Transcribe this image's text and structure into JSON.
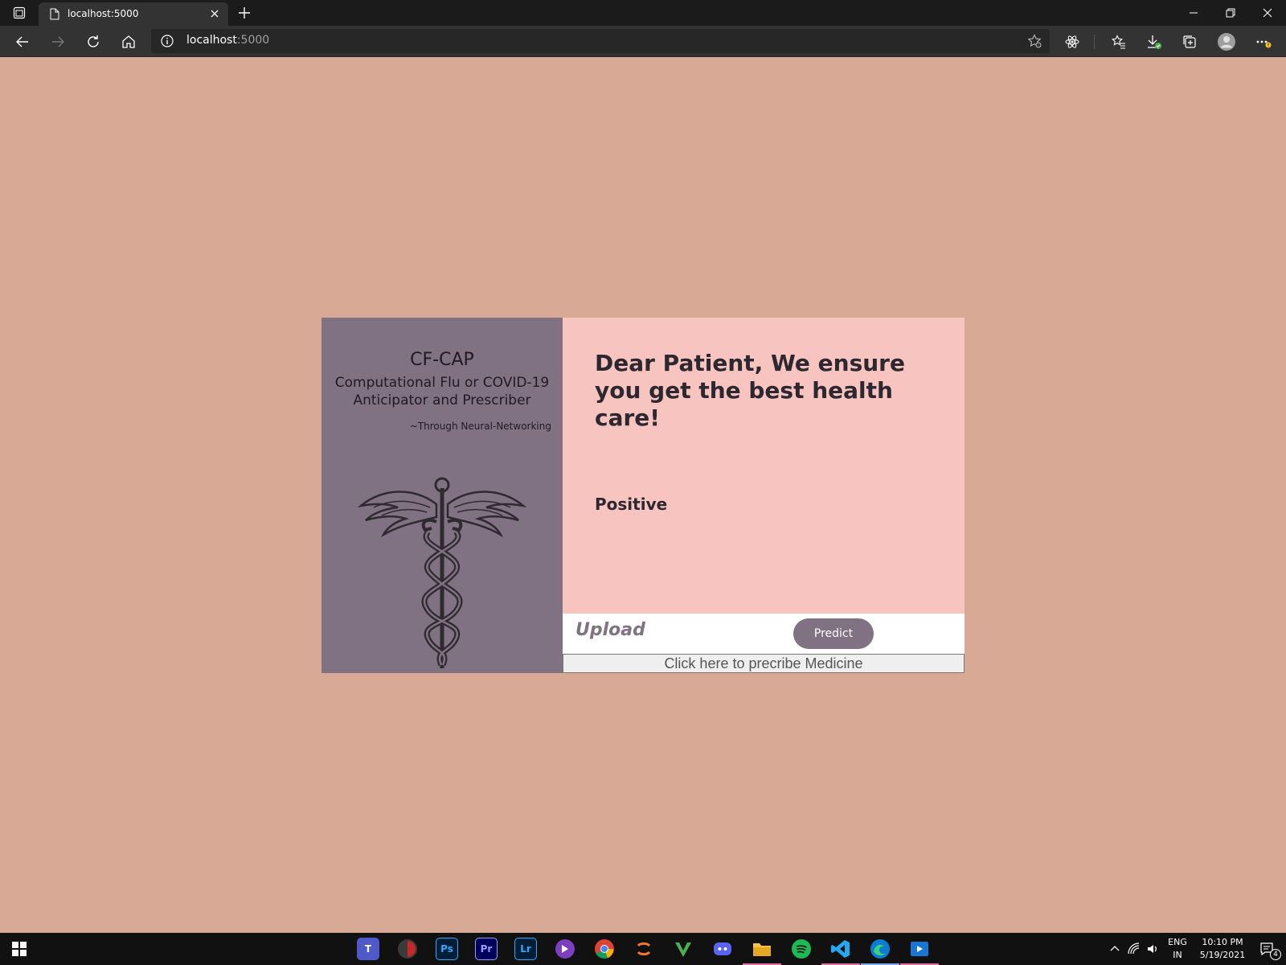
{
  "browser": {
    "tab_title": "localhost:5000",
    "address_host": "localhost",
    "address_port": ":5000"
  },
  "page": {
    "brand": "CF-CAP",
    "full_name_line1": "Computational Flu or COVID-19",
    "full_name_line2": "Anticipator and Prescriber",
    "tagline": "~Through Neural-Networking",
    "greeting": "Dear Patient, We ensure you get the best health care!",
    "result": "Positive",
    "upload_label": "Upload",
    "predict_label": "Predict",
    "prescribe_label": "Click here to precribe Medicine"
  },
  "colors": {
    "page_background": "#d8a994",
    "left_panel": "#807282",
    "right_panel": "#f7c4c0",
    "accent": "#807282"
  },
  "taskbar": {
    "apps": [
      "teams-icon",
      "app-icon",
      "photoshop-icon",
      "premiere-icon",
      "lightroom-icon",
      "app-icon",
      "chrome-icon",
      "app-icon",
      "app-icon",
      "discord-icon",
      "file-explorer-icon",
      "spotify-icon",
      "vscode-icon",
      "edge-icon",
      "app-icon"
    ],
    "lang_line1": "ENG",
    "lang_line2": "IN",
    "time": "10:10 PM",
    "date": "5/19/2021",
    "notifications": "4"
  }
}
